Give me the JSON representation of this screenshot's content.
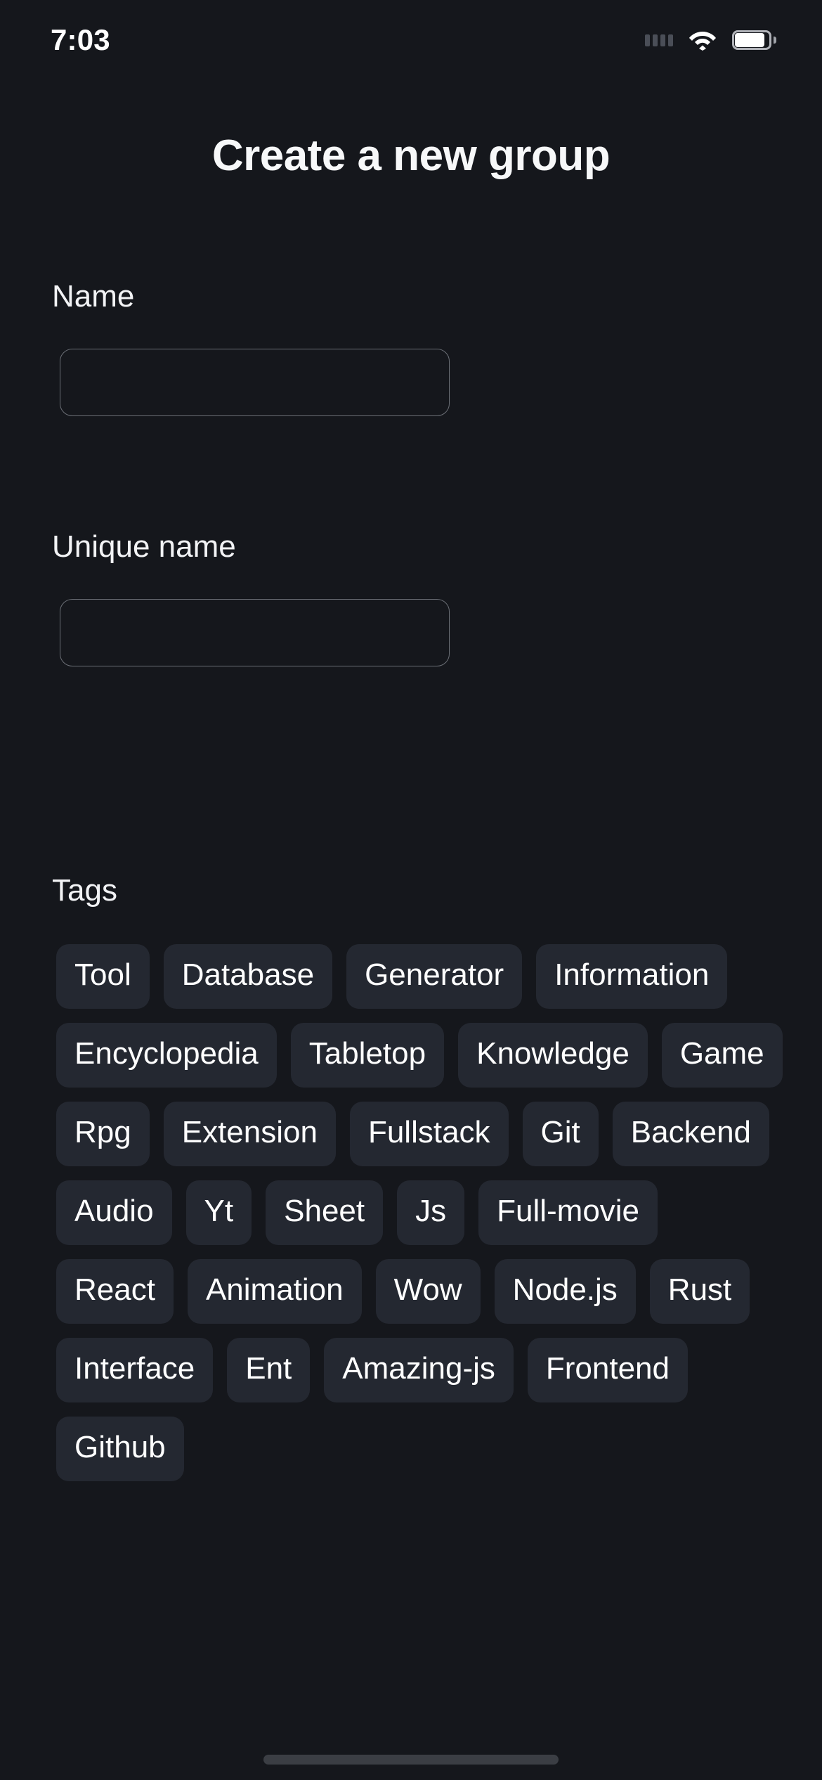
{
  "status_bar": {
    "time": "7:03",
    "cellular_icon": "cellular-dots-icon",
    "wifi_icon": "wifi-icon",
    "battery_icon": "battery-full-icon"
  },
  "header": {
    "title": "Create a new group"
  },
  "form": {
    "name_field": {
      "label": "Name",
      "value": "",
      "placeholder": ""
    },
    "unique_name_field": {
      "label": "Unique name",
      "value": "",
      "placeholder": ""
    }
  },
  "tags": {
    "label": "Tags",
    "items": [
      "Tool",
      "Database",
      "Generator",
      "Information",
      "Encyclopedia",
      "Tabletop",
      "Knowledge",
      "Game",
      "Rpg",
      "Extension",
      "Fullstack",
      "Git",
      "Backend",
      "Audio",
      "Yt",
      "Sheet",
      "Js",
      "Full-movie",
      "React",
      "Animation",
      "Wow",
      "Node.js",
      "Rust",
      "Interface",
      "Ent",
      "Amazing-js",
      "Frontend",
      "Github"
    ]
  },
  "colors": {
    "background": "#15171c",
    "chip_background": "#242831",
    "text_primary": "#f2f3f5",
    "input_border": "#6b6f76",
    "home_indicator": "#3b3e44"
  },
  "home_indicator": {
    "name": "home-indicator"
  }
}
